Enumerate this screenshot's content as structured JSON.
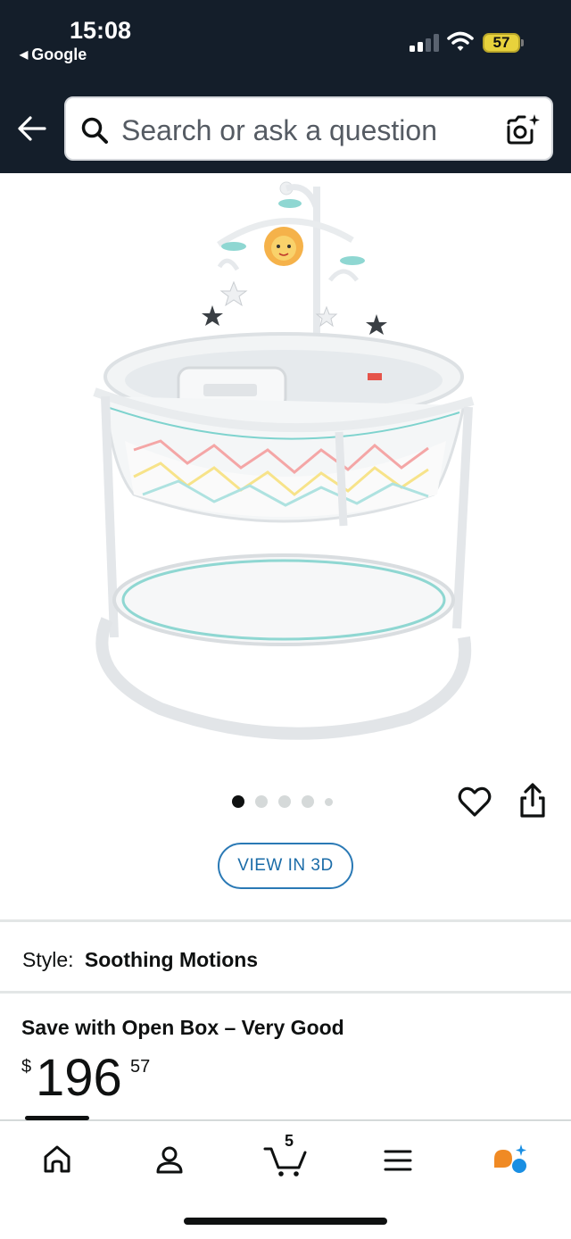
{
  "status_bar": {
    "time": "15:08",
    "back_app": "Google",
    "battery": "57"
  },
  "header": {
    "search_placeholder": "Search or ask a question"
  },
  "carousel": {
    "image_count": 5,
    "active_index": 0
  },
  "actions": {
    "view_3d": "VIEW IN 3D"
  },
  "style": {
    "label": "Style:",
    "value": "Soothing Motions"
  },
  "offer": {
    "title": "Save with Open Box – Very Good",
    "currency": "$",
    "price_whole": "196",
    "price_fraction": "57"
  },
  "tabbar": {
    "cart_count": "5",
    "items": [
      "home-icon",
      "account-icon",
      "cart-icon",
      "menu-icon",
      "rufus-icon"
    ]
  },
  "colors": {
    "header_bg": "#141e2a",
    "link_blue": "#1b6ca8",
    "battery_yellow": "#e8d23c",
    "rufus_orange": "#f08a24",
    "rufus_blue": "#1a8fe3"
  }
}
